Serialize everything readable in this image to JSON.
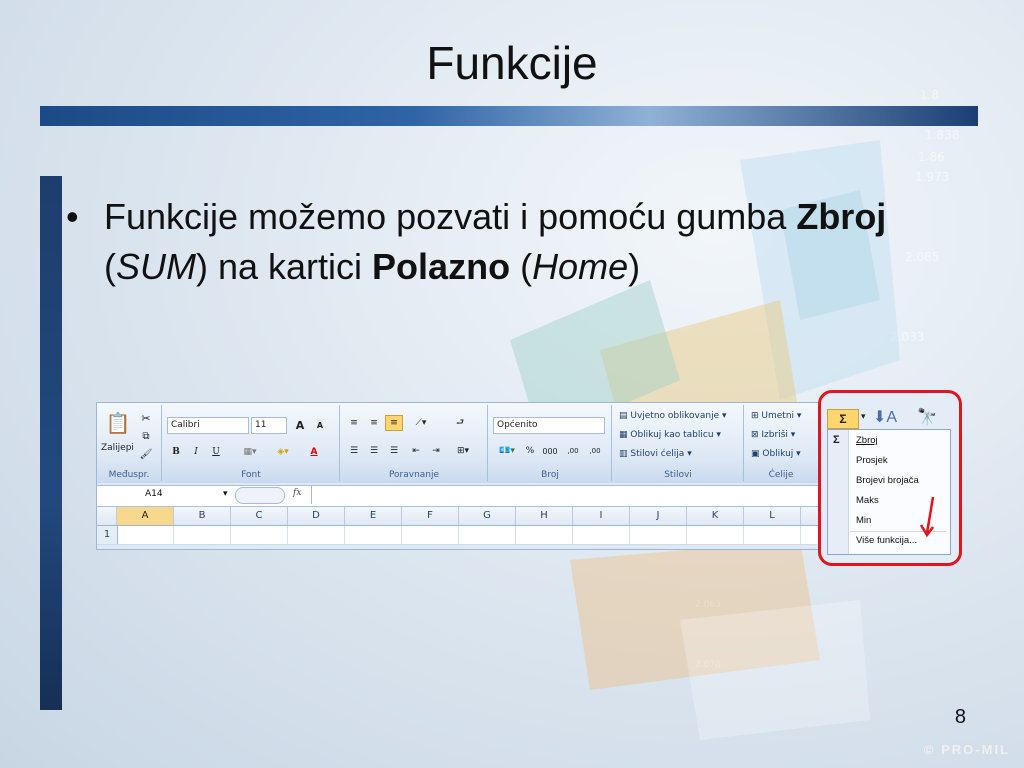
{
  "slide": {
    "title": "Funkcije",
    "bullet_prefix": "Funkcije možemo pozvati i pomoću gumba ",
    "bullet_bold1": "Zbroj",
    "bullet_paren1_open": " (",
    "bullet_italic1": "SUM",
    "bullet_mid": ") na kartici ",
    "bullet_bold2": "Polazno",
    "bullet_paren2_open": " (",
    "bullet_italic2": "Home",
    "bullet_close": ")",
    "page_number": "8",
    "copyright": "© PRO-MIL"
  },
  "ribbon": {
    "clipboard": {
      "paste_label": "Zalijepi",
      "group_label": "Međuspr."
    },
    "font": {
      "name": "Calibri",
      "size": "11",
      "bold": "B",
      "italic": "I",
      "underline": "U",
      "grow": "A",
      "shrink": "A",
      "color": "A",
      "group_label": "Font"
    },
    "alignment": {
      "group_label": "Poravnanje"
    },
    "number": {
      "format": "Općenito",
      "percent": "%",
      "thousands": "000",
      "inc_dec": ",00",
      "dec_dec": ",00",
      "group_label": "Broj"
    },
    "styles": {
      "conditional": "Uvjetno oblikovanje",
      "as_table": "Oblikuj kao tablicu",
      "cell_styles": "Stilovi ćelija",
      "group_label": "Stilovi"
    },
    "cells": {
      "insert": "Umetni",
      "delete": "Izbriši",
      "format": "Oblikuj",
      "group_label": "Ćelije"
    }
  },
  "formula_bar": {
    "name_box": "A14",
    "fx": "fx"
  },
  "sheet": {
    "columns": [
      "A",
      "B",
      "C",
      "D",
      "E",
      "F",
      "G",
      "H",
      "I",
      "J",
      "K",
      "L"
    ],
    "selected_column": "A",
    "rows": [
      "1"
    ]
  },
  "sum_menu": {
    "button": "Σ",
    "items": [
      "Zbroj",
      "Prosjek",
      "Brojevi brojača",
      "Maks",
      "Min",
      "Više funkcija..."
    ]
  },
  "colors": {
    "highlight": "#e0151e",
    "accent": "#1c4a86",
    "selected": "#ffd66e"
  }
}
